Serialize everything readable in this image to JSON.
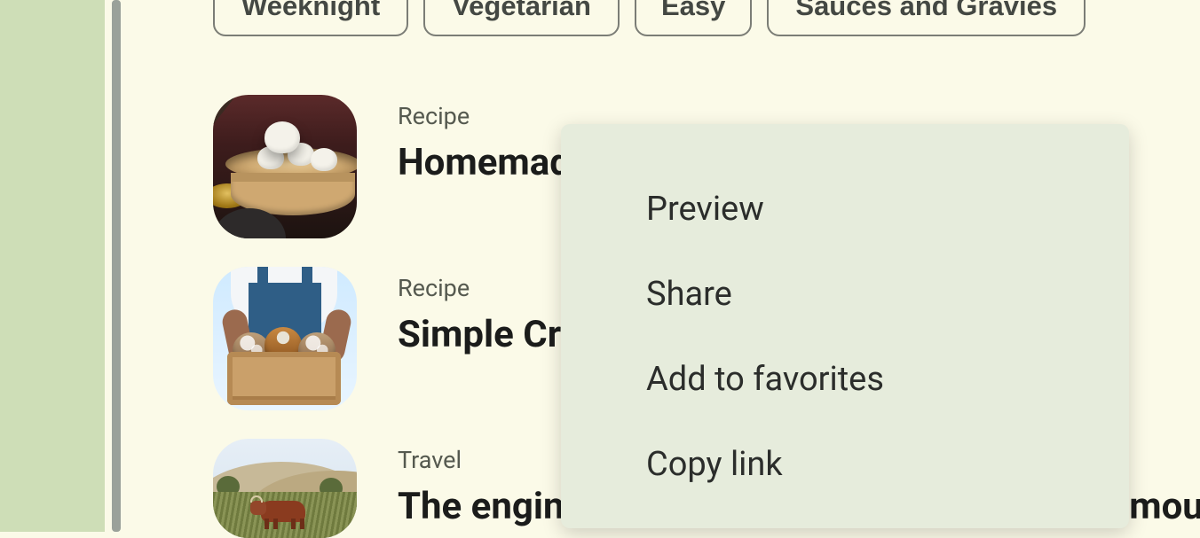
{
  "chips": [
    {
      "label": "Weeknight"
    },
    {
      "label": "Vegetarian"
    },
    {
      "label": "Easy"
    },
    {
      "label": "Sauces and Gravies"
    }
  ],
  "items": [
    {
      "kicker": "Recipe",
      "title": "Homemade Bao Buns with Pork Belly"
    },
    {
      "kicker": "Recipe",
      "title": "Simple Crusty Sourdough Loaves"
    },
    {
      "kicker": "Travel",
      "title": "The engineering brilliance of India's most famous trombs"
    }
  ],
  "context_menu": {
    "preview": "Preview",
    "share": "Share",
    "add_favorites": "Add to favorites",
    "copy_link": "Copy link"
  }
}
